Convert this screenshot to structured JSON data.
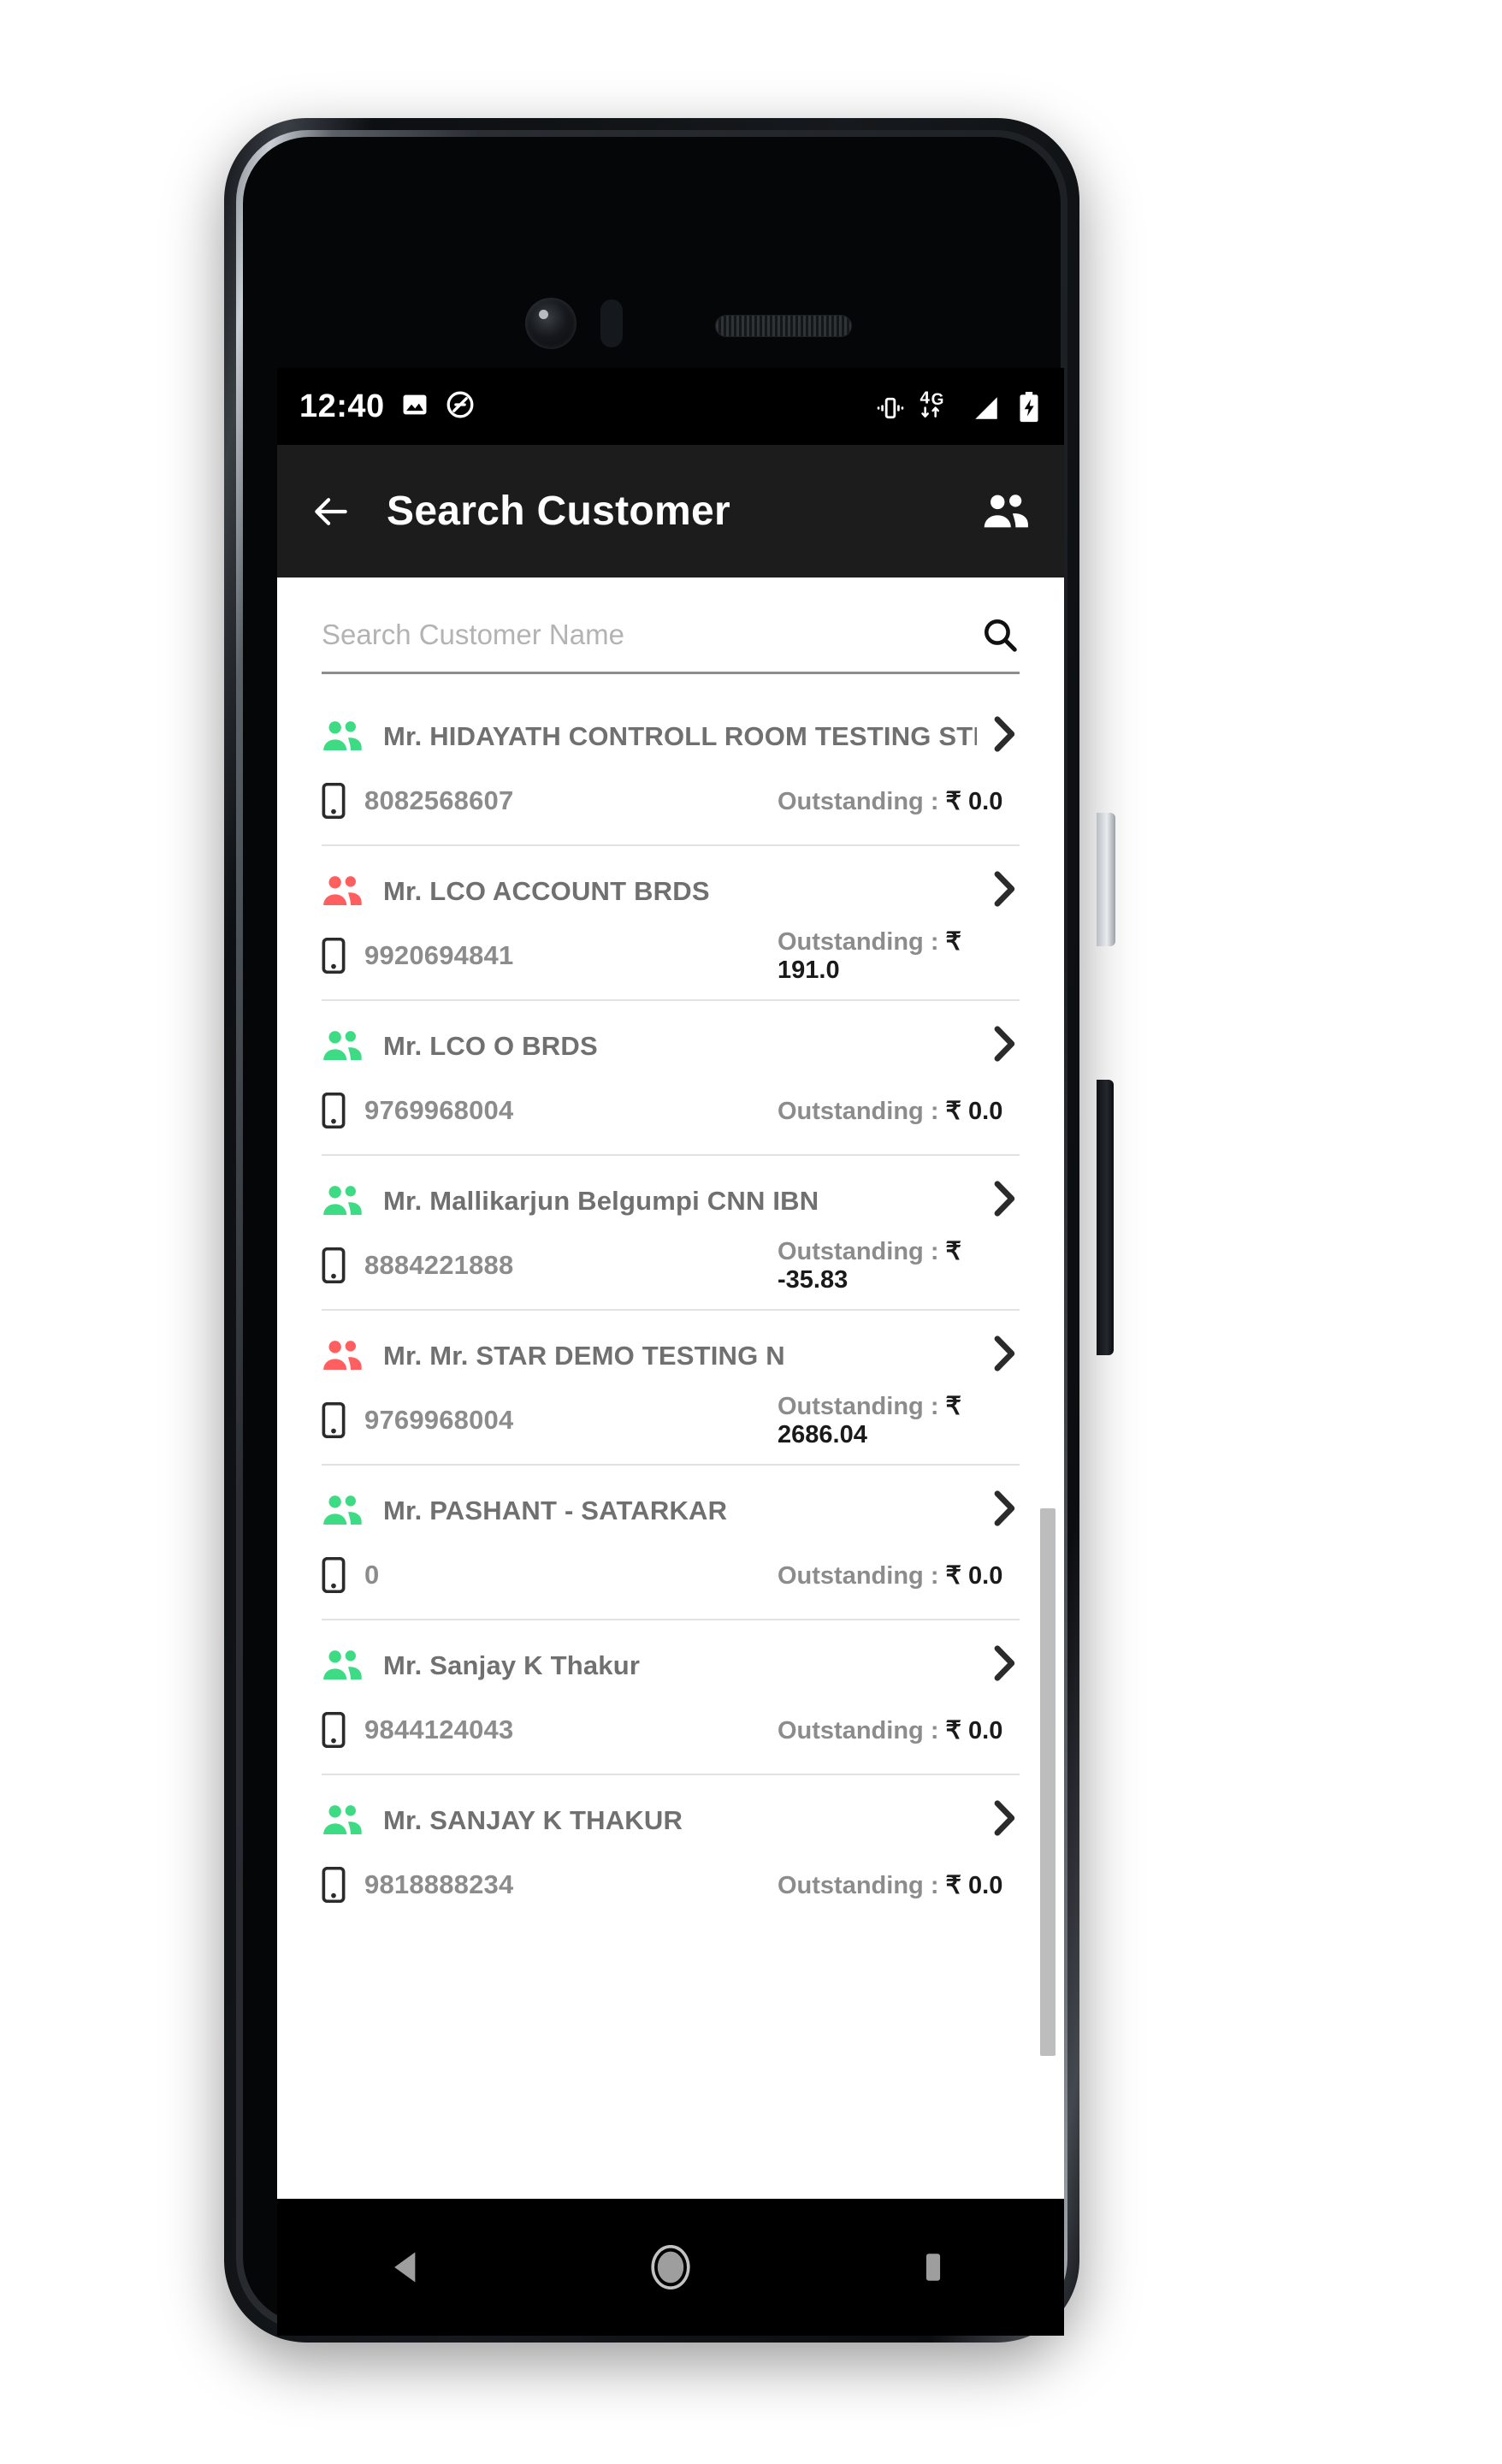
{
  "status_bar": {
    "time": "12:40",
    "left_icons": [
      "image-icon",
      "do-not-disturb-icon"
    ],
    "right_icons": [
      "vibrate-icon",
      "4g-data-icon",
      "signal-icon",
      "battery-charging-icon"
    ],
    "network_label": "4G"
  },
  "app_bar": {
    "back_label": "back-arrow-icon",
    "title": "Search Customer",
    "action_icon": "people-icon"
  },
  "search": {
    "placeholder": "Search Customer Name",
    "value": "",
    "icon": "search-icon"
  },
  "list": {
    "outstanding_label": "Outstanding : ",
    "currency": "₹",
    "avatar_color_paid": "#3ddc84",
    "avatar_color_due": "#ff5f5f",
    "customers": [
      {
        "name": "Mr. HIDAYATH CONTROLL ROOM  TESTING STB HARAPNALLI",
        "phone": "8082568607",
        "outstanding": "0.0",
        "status": "paid"
      },
      {
        "name": "Mr. LCO ACCOUNT  BRDS",
        "phone": "9920694841",
        "outstanding": "191.0",
        "status": "due"
      },
      {
        "name": "Mr. LCO O BRDS",
        "phone": "9769968004",
        "outstanding": "0.0",
        "status": "paid"
      },
      {
        "name": "Mr. Mallikarjun Belgumpi CNN IBN",
        "phone": "8884221888",
        "outstanding": "-35.83",
        "status": "paid"
      },
      {
        "name": "Mr. Mr. STAR DEMO TESTING  N",
        "phone": "9769968004",
        "outstanding": "2686.04",
        "status": "due"
      },
      {
        "name": "Mr. PASHANT - SATARKAR",
        "phone": "0",
        "outstanding": "0.0",
        "status": "paid"
      },
      {
        "name": "Mr. Sanjay K Thakur",
        "phone": "9844124043",
        "outstanding": "0.0",
        "status": "paid"
      },
      {
        "name": "Mr. SANJAY K THAKUR",
        "phone": "9818888234",
        "outstanding": "0.0",
        "status": "paid"
      }
    ]
  },
  "navigation_bar": {
    "back": "nav-back-icon",
    "home": "nav-home-icon",
    "recents": "nav-recents-icon"
  }
}
